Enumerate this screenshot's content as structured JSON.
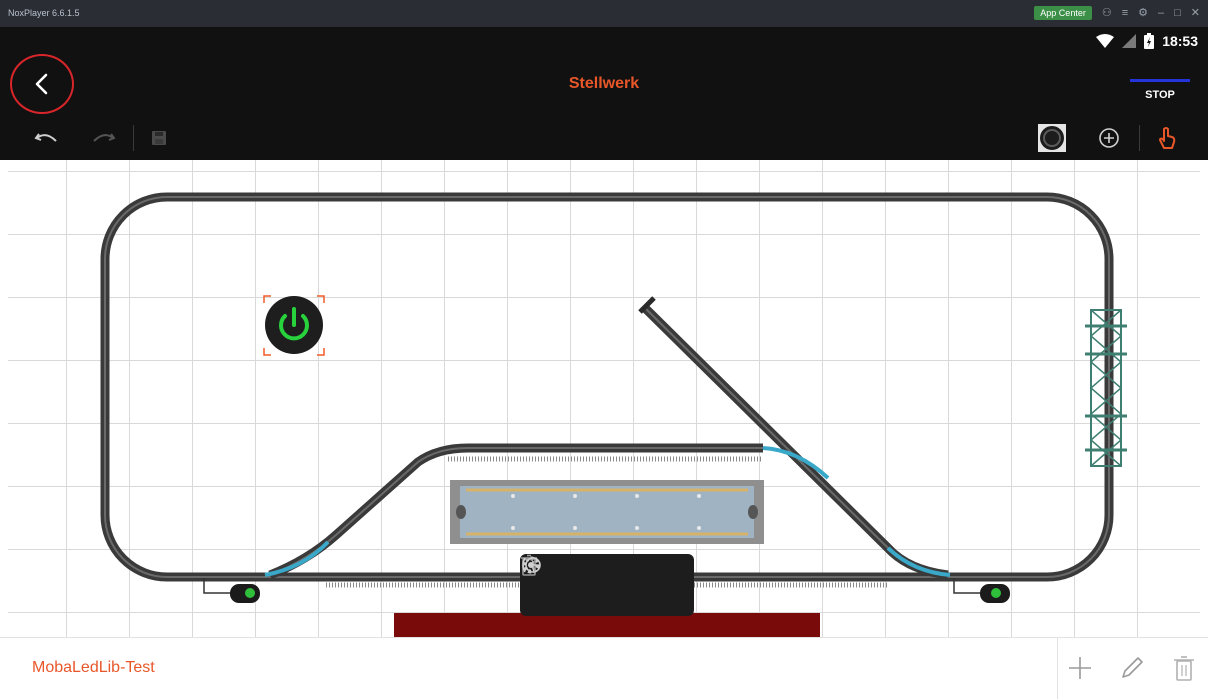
{
  "emulator": {
    "title": "NoxPlayer 6.6.1.5",
    "app_center_label": "App Center",
    "controls": [
      "⚇",
      "≡",
      "⚙",
      "–",
      "□",
      "✕"
    ]
  },
  "status_bar": {
    "time": "18:53",
    "icons": [
      "wifi-icon",
      "signal-icon",
      "battery-icon"
    ]
  },
  "header": {
    "title": "Stellwerk",
    "stop_label": "STOP",
    "back_icon": "chevron-left-icon"
  },
  "toolbar": {
    "left": [
      "undo-icon",
      "redo-icon",
      "save-icon"
    ],
    "right": [
      "power-block-icon",
      "add-circle-icon",
      "touch-hand-icon"
    ]
  },
  "floating_toolbar": [
    "settings-icon",
    "trash-icon",
    "add-circle-icon"
  ],
  "bottom_bar": {
    "layout_name": "MobaLedLib-Test",
    "actions": [
      "plus-icon",
      "pencil-icon",
      "trash-icon"
    ]
  },
  "colors": {
    "accent": "#e8572a",
    "header_bg": "#111111",
    "track": "#3a3a3a",
    "switch_track": "#3aa9c9",
    "power_green": "#28d23c",
    "stop_line": "#2334d8"
  }
}
